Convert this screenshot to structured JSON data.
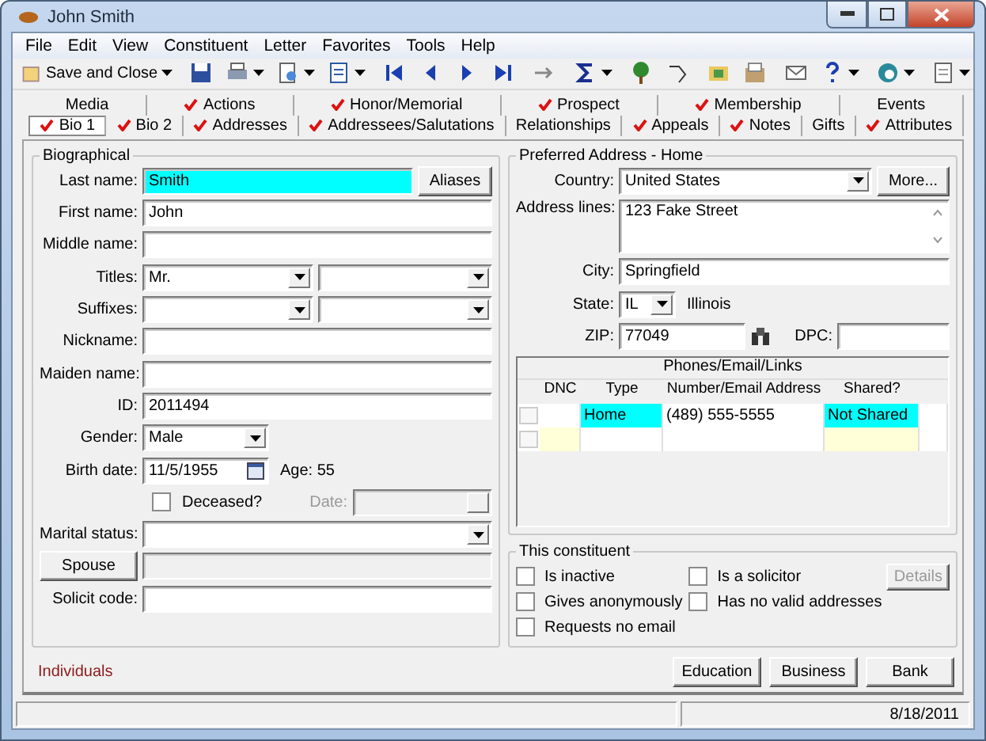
{
  "window": {
    "title": "John Smith"
  },
  "menu": [
    "File",
    "Edit",
    "View",
    "Constituent",
    "Letter",
    "Favorites",
    "Tools",
    "Help"
  ],
  "toolbar": {
    "save_label": "Save and Close"
  },
  "tab_rows": [
    [
      {
        "label": "Media",
        "checked": false,
        "selected": false
      },
      {
        "label": "Actions",
        "checked": true,
        "selected": false
      },
      {
        "label": "Honor/Memorial",
        "checked": true,
        "selected": false
      },
      {
        "label": "Prospect",
        "checked": true,
        "selected": false
      },
      {
        "label": "Membership",
        "checked": true,
        "selected": false
      },
      {
        "label": "Events",
        "checked": false,
        "selected": false
      }
    ],
    [
      {
        "label": "Bio 1",
        "checked": true,
        "selected": true
      },
      {
        "label": "Bio 2",
        "checked": true,
        "selected": false
      },
      {
        "label": "Addresses",
        "checked": true,
        "selected": false
      },
      {
        "label": "Addressees/Salutations",
        "checked": true,
        "selected": false
      },
      {
        "label": "Relationships",
        "checked": false,
        "selected": false
      },
      {
        "label": "Appeals",
        "checked": true,
        "selected": false
      },
      {
        "label": "Notes",
        "checked": true,
        "selected": false
      },
      {
        "label": "Gifts",
        "checked": false,
        "selected": false
      },
      {
        "label": "Attributes",
        "checked": true,
        "selected": false
      }
    ]
  ],
  "biographical": {
    "title": "Biographical",
    "fields": [
      {
        "kind": "text",
        "label": "Last name:",
        "value": "Smith",
        "highlighted": true,
        "button": "Aliases"
      },
      {
        "kind": "text",
        "label": "First name:",
        "value": "John"
      },
      {
        "kind": "text",
        "label": "Middle name:"
      },
      {
        "kind": "combo_pair",
        "label": "Titles:",
        "value": "Mr."
      },
      {
        "kind": "combo_pair",
        "label": "Suffixes:"
      },
      {
        "kind": "text",
        "label": "Nickname:"
      },
      {
        "kind": "text",
        "label": "Maiden name:"
      },
      {
        "kind": "text",
        "label": "ID:",
        "value": "2011494"
      },
      {
        "kind": "combo_short",
        "label": "Gender:",
        "value": "Male"
      },
      {
        "kind": "date",
        "label": "Birth date:",
        "value": "11/5/1955",
        "note": "Age: 55"
      },
      {
        "kind": "check_date",
        "label": "Deceased?",
        "checked": false,
        "date_label": "Date:",
        "disabled": true
      },
      {
        "kind": "combo",
        "label": "Marital status:"
      },
      {
        "kind": "button_field",
        "button": "Spouse",
        "disabled": true
      },
      {
        "kind": "text",
        "label": "Solicit code:"
      }
    ]
  },
  "address": {
    "title": "Preferred Address - Home",
    "fields": [
      {
        "kind": "combo",
        "label": "Country:",
        "value": "United States",
        "button": "More..."
      },
      {
        "kind": "textarea",
        "label": "Address lines:",
        "value": "123 Fake Street"
      },
      {
        "kind": "text",
        "label": "City:",
        "value": "Springfield"
      },
      {
        "kind": "state",
        "label": "State:",
        "value": "IL",
        "note": "Illinois"
      },
      {
        "kind": "zip",
        "label": "ZIP:",
        "value": "77049",
        "second_label": "DPC:"
      }
    ]
  },
  "contacts": {
    "title": "Phones/Email/Links",
    "columns": [
      "DNC",
      "Type",
      "Number/Email Address",
      "Shared?"
    ],
    "rows": [
      {
        "dnc": false,
        "type": "Home",
        "number": "(489) 555-5555",
        "shared": "Not Shared",
        "highlighted": true
      }
    ],
    "new_row": true
  },
  "constituent": {
    "title": "This constituent",
    "options": [
      {
        "label": "Is inactive",
        "checked": false
      },
      {
        "label": "Gives anonymously",
        "checked": false
      },
      {
        "label": "Requests no email",
        "checked": false
      },
      {
        "label": "Is a solicitor",
        "checked": false
      },
      {
        "label": "Has no valid addresses",
        "checked": false
      }
    ],
    "details_button": {
      "label": "Details",
      "disabled": true
    }
  },
  "record_type": "Individuals",
  "buttons": [
    "Education",
    "Business",
    "Bank"
  ],
  "status_bar": {
    "date": "8/18/2011"
  }
}
